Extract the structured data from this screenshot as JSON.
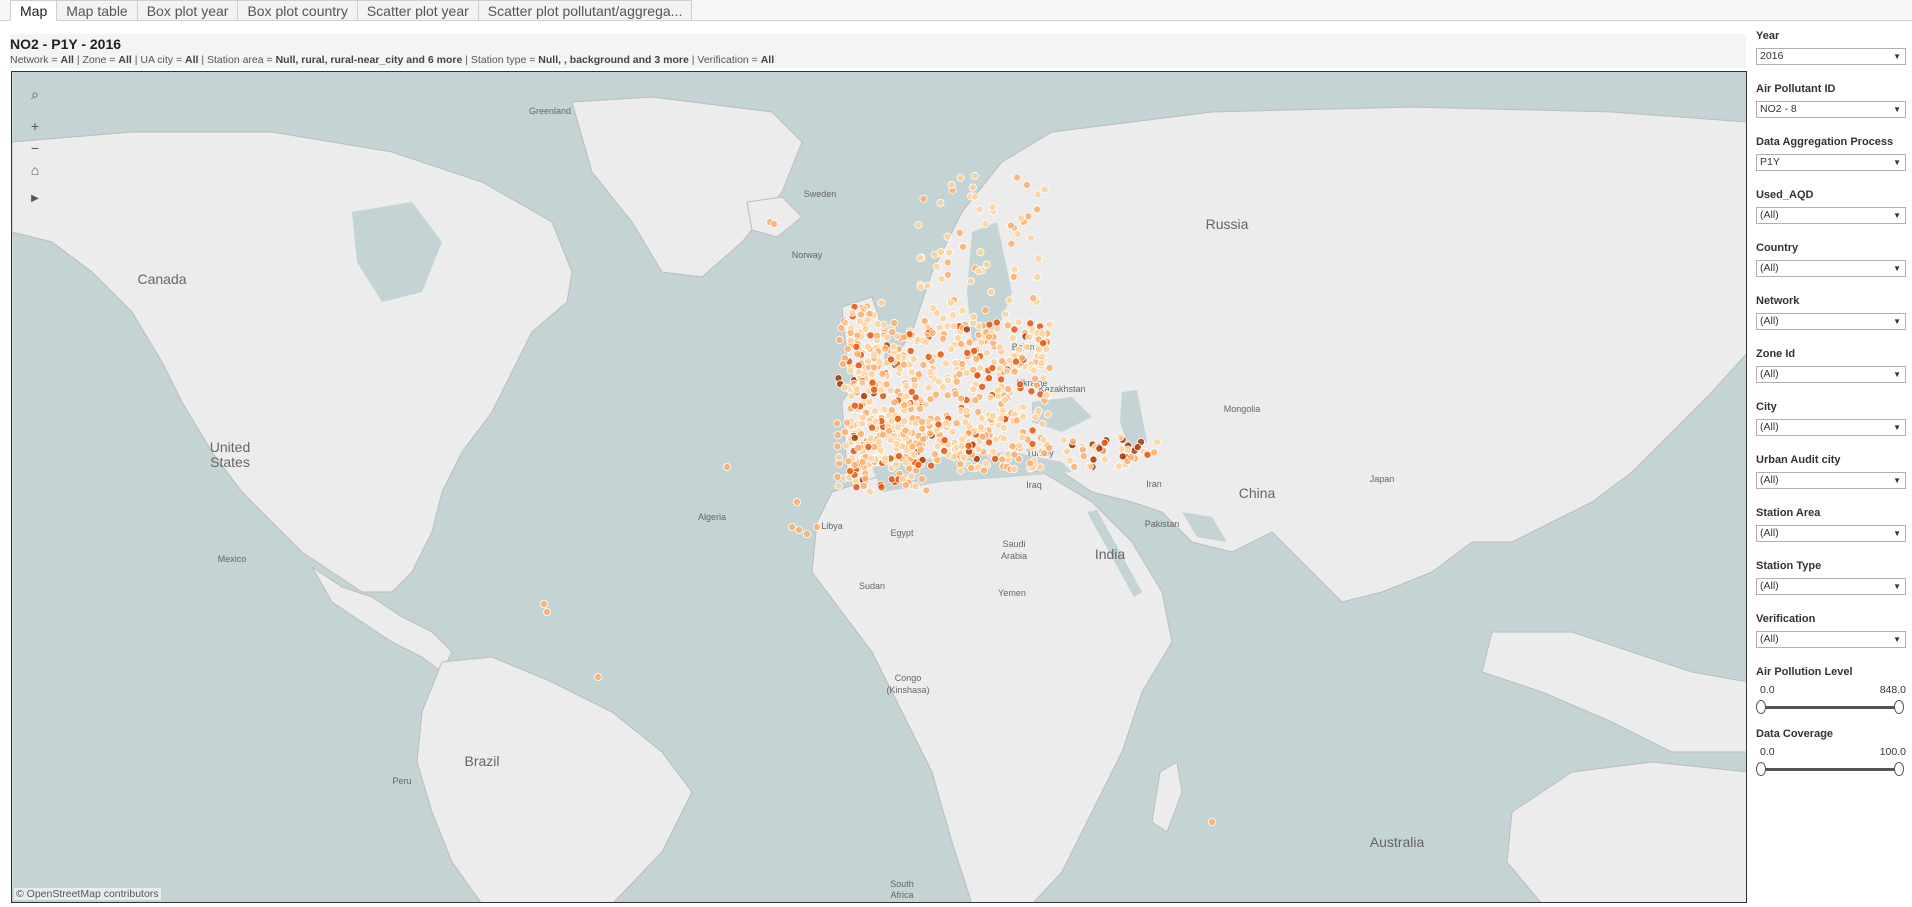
{
  "tabs": [
    "Map",
    "Map table",
    "Box plot year",
    "Box plot country",
    "Scatter plot year",
    "Scatter plot pollutant/aggrega..."
  ],
  "header": {
    "title": "NO2 - P1Y - 2016",
    "subtitle": [
      {
        "text": "Network = ",
        "bold": false
      },
      {
        "text": "All",
        "bold": true
      },
      {
        "text": " | Zone = ",
        "bold": false
      },
      {
        "text": "All",
        "bold": true
      },
      {
        "text": " | UA city = ",
        "bold": false
      },
      {
        "text": "All",
        "bold": true
      },
      {
        "text": " | Station area = ",
        "bold": false
      },
      {
        "text": "Null, rural, rural-near_city and 6 more",
        "bold": true
      },
      {
        "text": " | Station type = ",
        "bold": false
      },
      {
        "text": "Null, , background and 3 more",
        "bold": true
      },
      {
        "text": " | Verification = ",
        "bold": false
      },
      {
        "text": "All",
        "bold": true
      }
    ]
  },
  "map": {
    "copyright": "© OpenStreetMap contributors",
    "tools": [
      "search-icon",
      "zoom-in-icon",
      "zoom-out-icon",
      "home-icon",
      "play-icon"
    ],
    "tool_glyphs": [
      "⌕",
      "+",
      "−",
      "⌂",
      "▶"
    ],
    "labels": [
      "Greenland",
      "Sweden",
      "Norway",
      "Canada",
      "Russia",
      "Belarus",
      "Ukraine",
      "Kazakhstan",
      "Mongolia",
      "United",
      "States",
      "Algeria",
      "Libya",
      "Egypt",
      "Iraq",
      "Iran",
      "Turkey",
      "Saudi",
      "Arabia",
      "Pakistan",
      "India",
      "China",
      "Japan",
      "Mexico",
      "Sudan",
      "Yemen",
      "Congo",
      "(Kinshasa)",
      "Brazil",
      "Peru",
      "Australia",
      "South",
      "Africa"
    ],
    "marker_colors": {
      "low": "#fdd49e",
      "mid": "#fdae6b",
      "high": "#e6550d",
      "max": "#a63603"
    }
  },
  "filters": [
    {
      "label": "Year",
      "value": "2016"
    },
    {
      "label": "Air Pollutant ID",
      "value": "NO2 - 8"
    },
    {
      "label": "Data Aggregation Process",
      "value": "P1Y"
    },
    {
      "label": "Used_AQD",
      "value": "(All)"
    },
    {
      "label": "Country",
      "value": "(All)"
    },
    {
      "label": "Network",
      "value": "(All)"
    },
    {
      "label": "Zone Id",
      "value": "(All)"
    },
    {
      "label": "City",
      "value": "(All)"
    },
    {
      "label": "Urban Audit city",
      "value": "(All)"
    },
    {
      "label": "Station Area",
      "value": "(All)"
    },
    {
      "label": "Station Type",
      "value": "(All)"
    },
    {
      "label": "Verification",
      "value": "(All)"
    }
  ],
  "ranges": [
    {
      "label": "Air Pollution Level",
      "min": "0.0",
      "max": "848.0",
      "min_frac": 0.0,
      "max_frac": 1.0
    },
    {
      "label": "Data Coverage",
      "min": "0.0",
      "max": "100.0",
      "min_frac": 0.0,
      "max_frac": 1.0
    }
  ]
}
